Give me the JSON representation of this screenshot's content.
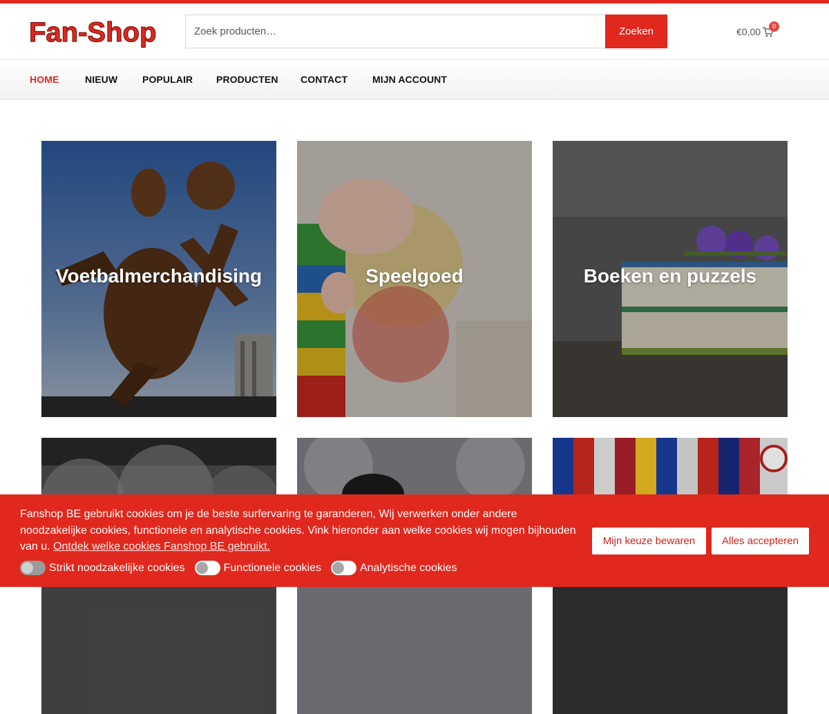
{
  "header": {
    "logo_text": "Fan-Shop",
    "search": {
      "placeholder": "Zoek producten…",
      "button_label": "Zoeken"
    },
    "cart": {
      "total": "€0,00",
      "count": "0",
      "icon": "cart-icon"
    }
  },
  "nav": {
    "items": [
      {
        "label": "HOME",
        "active": true
      },
      {
        "label": "NIEUW"
      },
      {
        "label": "POPULAIR"
      },
      {
        "label": "PRODUCTEN"
      },
      {
        "label": "CONTACT"
      },
      {
        "label": "MIJN ACCOUNT"
      }
    ]
  },
  "categories": [
    {
      "title": "Voetbalmerchandising"
    },
    {
      "title": "Speelgoed"
    },
    {
      "title": "Boeken en puzzels"
    },
    {
      "title": ""
    },
    {
      "title": ""
    },
    {
      "title": ""
    }
  ],
  "cookie": {
    "text": "Fanshop BE gebruikt cookies om je de beste surfervaring te garanderen, Wij verwerken onder andere noodzakelijke cookies, functionele en analytische cookies. Vink hieronder aan welke cookies wij mogen bijhouden van u.",
    "link": "Ontdek welke cookies Fanshop BE gebruikt.",
    "save_label": "Mijn keuze bewaren",
    "accept_label": "Alles accepteren",
    "toggles": [
      {
        "label": "Strikt noodzakelijke cookies",
        "checked": true
      },
      {
        "label": "Functionele cookies",
        "checked": false
      },
      {
        "label": "Analytische cookies",
        "checked": false
      }
    ]
  },
  "colors": {
    "accent": "#e0281e",
    "text": "#111111"
  }
}
